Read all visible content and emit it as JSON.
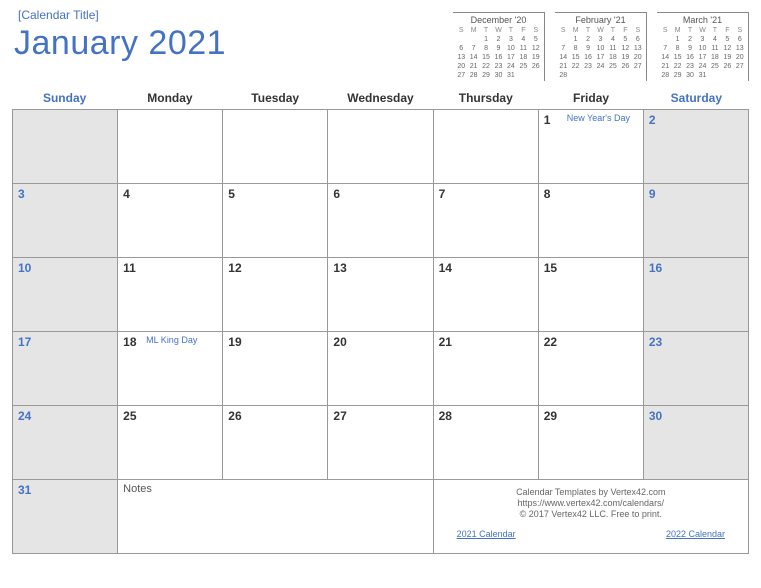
{
  "placeholder": "[Calendar Title]",
  "title": "January  2021",
  "dow": [
    "Sunday",
    "Monday",
    "Tuesday",
    "Wednesday",
    "Thursday",
    "Friday",
    "Saturday"
  ],
  "mini": [
    {
      "title": "December '20",
      "dow": [
        "S",
        "M",
        "T",
        "W",
        "T",
        "F",
        "S"
      ],
      "days": [
        "",
        "",
        "1",
        "2",
        "3",
        "4",
        "5",
        "6",
        "7",
        "8",
        "9",
        "10",
        "11",
        "12",
        "13",
        "14",
        "15",
        "16",
        "17",
        "18",
        "19",
        "20",
        "21",
        "22",
        "23",
        "24",
        "25",
        "26",
        "27",
        "28",
        "29",
        "30",
        "31",
        "",
        "",
        "",
        "",
        "",
        "",
        "",
        "",
        ""
      ]
    },
    {
      "title": "February '21",
      "dow": [
        "S",
        "M",
        "T",
        "W",
        "T",
        "F",
        "S"
      ],
      "days": [
        "",
        "1",
        "2",
        "3",
        "4",
        "5",
        "6",
        "7",
        "8",
        "9",
        "10",
        "11",
        "12",
        "13",
        "14",
        "15",
        "16",
        "17",
        "18",
        "19",
        "20",
        "21",
        "22",
        "23",
        "24",
        "25",
        "26",
        "27",
        "28",
        "",
        "",
        "",
        "",
        "",
        "",
        "",
        "",
        "",
        "",
        "",
        "",
        ""
      ]
    },
    {
      "title": "March '21",
      "dow": [
        "S",
        "M",
        "T",
        "W",
        "T",
        "F",
        "S"
      ],
      "days": [
        "",
        "1",
        "2",
        "3",
        "4",
        "5",
        "6",
        "7",
        "8",
        "9",
        "10",
        "11",
        "12",
        "13",
        "14",
        "15",
        "16",
        "17",
        "18",
        "19",
        "20",
        "21",
        "22",
        "23",
        "24",
        "25",
        "26",
        "27",
        "28",
        "29",
        "30",
        "31",
        "",
        "",
        "",
        "",
        "",
        "",
        "",
        "",
        "",
        ""
      ]
    }
  ],
  "weeks": [
    [
      {
        "n": "",
        "g": true
      },
      {
        "n": "",
        "g": false
      },
      {
        "n": "",
        "g": false
      },
      {
        "n": "",
        "g": false
      },
      {
        "n": "",
        "g": false
      },
      {
        "n": "1",
        "g": false,
        "e": "New Year's Day"
      },
      {
        "n": "2",
        "g": true,
        "w": true
      }
    ],
    [
      {
        "n": "3",
        "g": true,
        "w": true
      },
      {
        "n": "4"
      },
      {
        "n": "5"
      },
      {
        "n": "6"
      },
      {
        "n": "7"
      },
      {
        "n": "8"
      },
      {
        "n": "9",
        "g": true,
        "w": true
      }
    ],
    [
      {
        "n": "10",
        "g": true,
        "w": true
      },
      {
        "n": "11"
      },
      {
        "n": "12"
      },
      {
        "n": "13"
      },
      {
        "n": "14"
      },
      {
        "n": "15"
      },
      {
        "n": "16",
        "g": true,
        "w": true
      }
    ],
    [
      {
        "n": "17",
        "g": true,
        "w": true
      },
      {
        "n": "18",
        "e": "ML King Day"
      },
      {
        "n": "19"
      },
      {
        "n": "20"
      },
      {
        "n": "21"
      },
      {
        "n": "22"
      },
      {
        "n": "23",
        "g": true,
        "w": true
      }
    ],
    [
      {
        "n": "24",
        "g": true,
        "w": true
      },
      {
        "n": "25"
      },
      {
        "n": "26"
      },
      {
        "n": "27"
      },
      {
        "n": "28"
      },
      {
        "n": "29"
      },
      {
        "n": "30",
        "g": true,
        "w": true
      }
    ]
  ],
  "last_row": {
    "first": {
      "n": "31",
      "g": true,
      "w": true
    },
    "notes_label": "Notes",
    "footer": {
      "line1": "Calendar Templates by Vertex42.com",
      "line2": "https://www.vertex42.com/calendars/",
      "line3": "© 2017 Vertex42 LLC. Free to print.",
      "link1": "2021 Calendar",
      "link2": "2022 Calendar"
    }
  }
}
